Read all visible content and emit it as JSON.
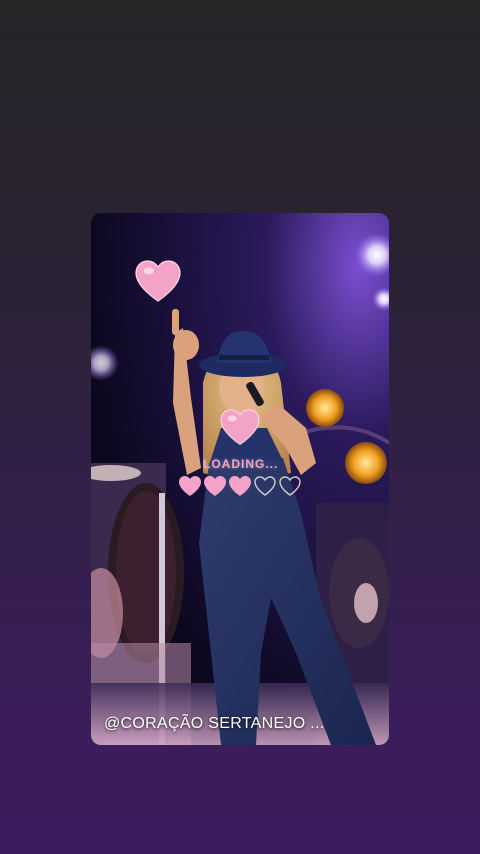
{
  "story": {
    "loading_text": "LOADING...",
    "loading_progress": {
      "filled": 3,
      "total": 5
    },
    "caption": "@CORAÇÃO SERTANEJO ...",
    "icons": [
      "heart-icon",
      "heart-outline-icon"
    ],
    "colors": {
      "background_top": "#262528",
      "background_bottom": "#3b1c5c",
      "heart_fill": "#f4a3c8",
      "heart_outline": "#cfcfcf",
      "loading_text": "#f4a3c3",
      "caption_text": "#ffffff"
    }
  }
}
